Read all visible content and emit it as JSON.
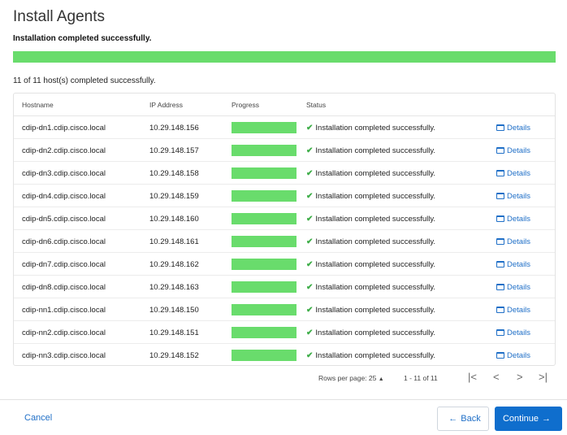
{
  "page": {
    "title": "Install Agents",
    "status_message": "Installation completed successfully.",
    "overall_progress_percent": 100,
    "summary": "11 of 11 host(s) completed successfully."
  },
  "table": {
    "columns": {
      "hostname": "Hostname",
      "ip": "IP Address",
      "progress": "Progress",
      "status": "Status"
    },
    "rows": [
      {
        "hostname": "cdip-dn1.cdip.cisco.local",
        "ip": "10.29.148.156",
        "progress_percent": 100,
        "status": "Installation completed successfully.",
        "details": "Details"
      },
      {
        "hostname": "cdip-dn2.cdip.cisco.local",
        "ip": "10.29.148.157",
        "progress_percent": 100,
        "status": "Installation completed successfully.",
        "details": "Details"
      },
      {
        "hostname": "cdip-dn3.cdip.cisco.local",
        "ip": "10.29.148.158",
        "progress_percent": 100,
        "status": "Installation completed successfully.",
        "details": "Details"
      },
      {
        "hostname": "cdip-dn4.cdip.cisco.local",
        "ip": "10.29.148.159",
        "progress_percent": 100,
        "status": "Installation completed successfully.",
        "details": "Details"
      },
      {
        "hostname": "cdip-dn5.cdip.cisco.local",
        "ip": "10.29.148.160",
        "progress_percent": 100,
        "status": "Installation completed successfully.",
        "details": "Details"
      },
      {
        "hostname": "cdip-dn6.cdip.cisco.local",
        "ip": "10.29.148.161",
        "progress_percent": 100,
        "status": "Installation completed successfully.",
        "details": "Details"
      },
      {
        "hostname": "cdip-dn7.cdip.cisco.local",
        "ip": "10.29.148.162",
        "progress_percent": 100,
        "status": "Installation completed successfully.",
        "details": "Details"
      },
      {
        "hostname": "cdip-dn8.cdip.cisco.local",
        "ip": "10.29.148.163",
        "progress_percent": 100,
        "status": "Installation completed successfully.",
        "details": "Details"
      },
      {
        "hostname": "cdip-nn1.cdip.cisco.local",
        "ip": "10.29.148.150",
        "progress_percent": 100,
        "status": "Installation completed successfully.",
        "details": "Details"
      },
      {
        "hostname": "cdip-nn2.cdip.cisco.local",
        "ip": "10.29.148.151",
        "progress_percent": 100,
        "status": "Installation completed successfully.",
        "details": "Details"
      },
      {
        "hostname": "cdip-nn3.cdip.cisco.local",
        "ip": "10.29.148.152",
        "progress_percent": 100,
        "status": "Installation completed successfully.",
        "details": "Details"
      }
    ]
  },
  "pagination": {
    "rows_per_page_label": "Rows per page: 25",
    "range": "1 - 11 of 11"
  },
  "footer": {
    "cancel": "Cancel",
    "back": "Back",
    "continue": "Continue"
  },
  "icons": {
    "success": "check-icon",
    "details": "document-icon",
    "back": "arrow-left-icon",
    "continue": "arrow-right-icon"
  },
  "colors": {
    "progress": "#69dc6c",
    "accent": "#0f6ecd",
    "success": "#3fae49"
  }
}
